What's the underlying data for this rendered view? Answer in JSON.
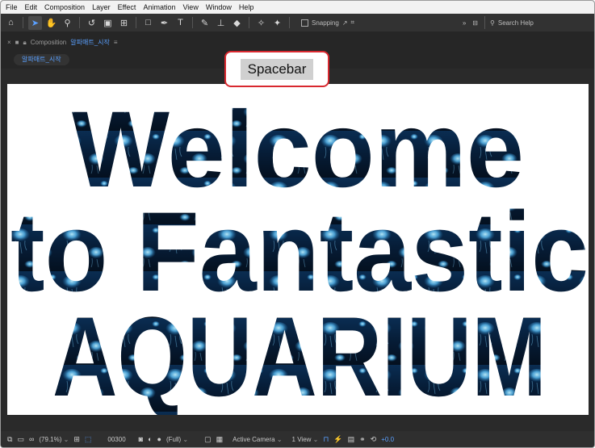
{
  "menu": [
    "File",
    "Edit",
    "Composition",
    "Layer",
    "Effect",
    "Animation",
    "View",
    "Window",
    "Help"
  ],
  "toolbar": {
    "snapping_label": "Snapping",
    "search_placeholder": "Search Help",
    "expand_glyph": "»"
  },
  "panel": {
    "type_label": "Composition",
    "comp_name": "알파매트_시작",
    "tab_label": "알파매트_시작"
  },
  "callout": {
    "label": "Spacebar"
  },
  "artwork": {
    "line1": "Welcome",
    "line2": "to Fantastic",
    "line3": "AQUARIUM"
  },
  "statusbar": {
    "zoom": "(79.1%)",
    "timecode": "00300",
    "resolution": "(Full)",
    "camera": "Active Camera",
    "views": "1 View",
    "exposure": "+0.0"
  },
  "colors": {
    "accent": "#5aa0ff",
    "callout_border": "#d8282f",
    "water_dark": "#061428",
    "jelly": "#5fc6ff"
  }
}
